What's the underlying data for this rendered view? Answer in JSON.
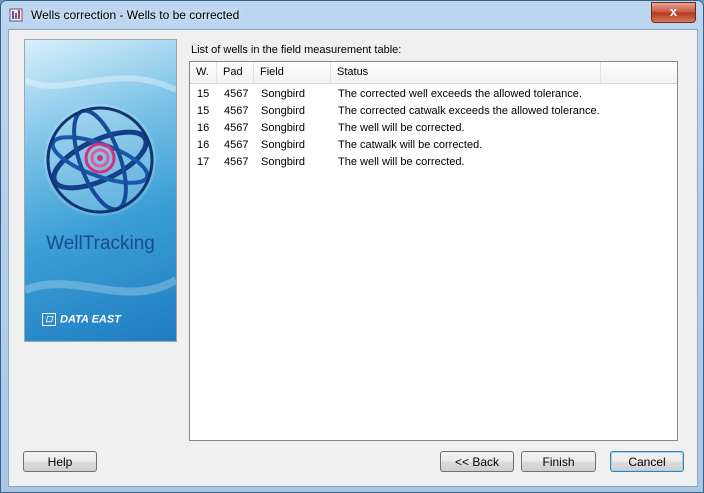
{
  "window": {
    "title": "Wells correction - Wells to be corrected",
    "close_label": "x"
  },
  "banner": {
    "product_name": "WellTracking",
    "company_logo_text": "DATA EAST",
    "colors": {
      "accent": "#1a4c8c",
      "target": "#d6307a"
    }
  },
  "list": {
    "caption": "List of wells in the field measurement table:",
    "columns": [
      "W.",
      "Pad",
      "Field",
      "Status"
    ],
    "rows": [
      {
        "w": "15",
        "pad": "4567",
        "field": "Songbird",
        "status": "The corrected well exceeds the allowed tolerance."
      },
      {
        "w": "15",
        "pad": "4567",
        "field": "Songbird",
        "status": "The corrected catwalk exceeds the allowed tolerance."
      },
      {
        "w": "16",
        "pad": "4567",
        "field": "Songbird",
        "status": "The well will be corrected."
      },
      {
        "w": "16",
        "pad": "4567",
        "field": "Songbird",
        "status": "The catwalk will be corrected."
      },
      {
        "w": "17",
        "pad": "4567",
        "field": "Songbird",
        "status": "The well will be corrected."
      }
    ]
  },
  "buttons": {
    "help": "Help",
    "back": "<< Back",
    "finish": "Finish",
    "cancel": "Cancel"
  }
}
